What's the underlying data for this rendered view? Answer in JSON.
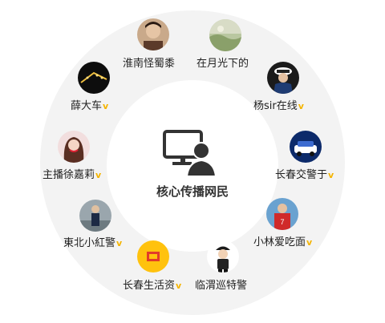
{
  "center": {
    "label": "核心传播网民",
    "icon": "monitor-user-icon"
  },
  "colors": {
    "ring": "#f3f3f3",
    "core": "#ffffff",
    "verified_badge": "#f4b400",
    "text": "#222222"
  },
  "nodes": [
    {
      "id": "n1",
      "label": "淮南怪蜀黍",
      "verified": "",
      "avatar": "person-photo-avatar"
    },
    {
      "id": "n2",
      "label": "在月光下的",
      "verified": "",
      "avatar": "landscape-photo-avatar"
    },
    {
      "id": "n3",
      "label": "杨sir在线",
      "verified": "v",
      "avatar": "police-officer-avatar"
    },
    {
      "id": "n4",
      "label": "长春交警于",
      "verified": "v",
      "avatar": "police-car-avatar"
    },
    {
      "id": "n5",
      "label": "小林爱吃面",
      "verified": "v",
      "avatar": "football-player-avatar"
    },
    {
      "id": "n6",
      "label": "临渭巡特警",
      "verified": "",
      "avatar": "police-cartoon-avatar"
    },
    {
      "id": "n7",
      "label": "长春生活资",
      "verified": "v",
      "avatar": "yellow-logo-avatar"
    },
    {
      "id": "n8",
      "label": "東北小紅警",
      "verified": "v",
      "avatar": "police-officer-photo-avatar"
    },
    {
      "id": "n9",
      "label": "主播徐嘉莉",
      "verified": "v",
      "avatar": "woman-photo-avatar"
    },
    {
      "id": "n10",
      "label": "薛大车",
      "verified": "v",
      "avatar": "night-lights-avatar"
    }
  ]
}
